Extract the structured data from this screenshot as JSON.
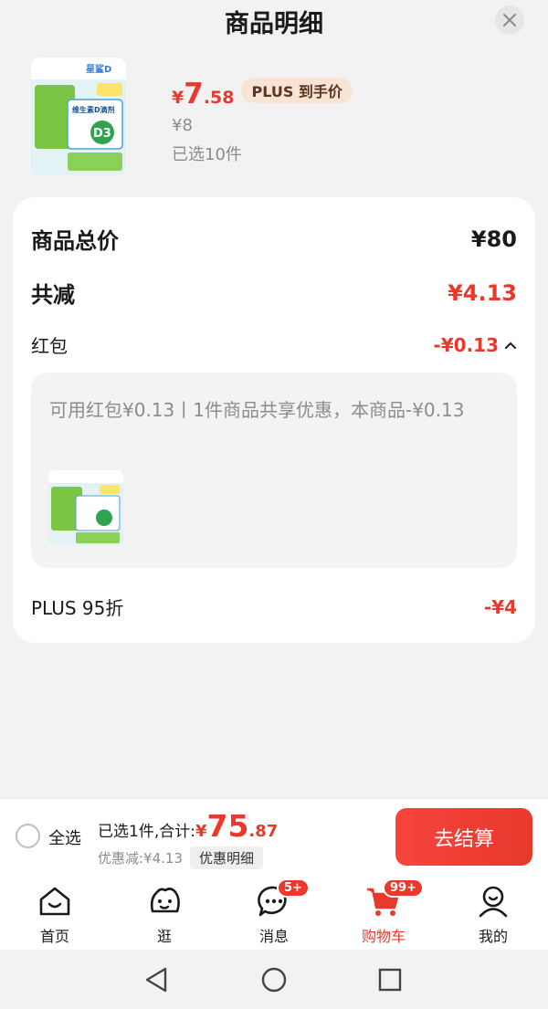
{
  "header": {
    "title": "商品明细"
  },
  "product": {
    "price_symbol": "¥",
    "price_int": "7",
    "price_dec": ".58",
    "plus_tag": "PLUS 到手价",
    "original_price": "¥8",
    "selected_count": "已选10件",
    "thumb_brand": "星鲨D",
    "thumb_name": "维生素D滴剂",
    "thumb_badge": "D3"
  },
  "details": {
    "total_label": "商品总价",
    "total_value": "¥80",
    "reduce_label": "共减",
    "reduce_value": "¥4.13",
    "hongbao_label": "红包",
    "hongbao_value": "-¥0.13",
    "hongbao_desc": "可用红包¥0.13丨1件商品共享优惠，本商品-¥0.13",
    "plus_label": "PLUS 95折",
    "plus_value": "-¥4"
  },
  "checkout": {
    "select_all": "全选",
    "sum_prefix": "已选1件,合计:",
    "sum_symbol": "¥",
    "sum_int": "75",
    "sum_dec": ".87",
    "discount_text": "优惠减:¥4.13",
    "discount_detail_button": "优惠明细",
    "submit_button": "去结算"
  },
  "tabs": [
    {
      "label": "首页",
      "icon": "home-icon"
    },
    {
      "label": "逛",
      "icon": "stroll-face-icon"
    },
    {
      "label": "消息",
      "icon": "message-icon",
      "badge": "5+"
    },
    {
      "label": "购物车",
      "icon": "cart-icon",
      "badge": "99+",
      "active": true
    },
    {
      "label": "我的",
      "icon": "profile-icon"
    }
  ],
  "colors": {
    "accent": "#e8392d",
    "plus_tag_bg": "#f8e3d5",
    "background": "#f2f2f2"
  }
}
